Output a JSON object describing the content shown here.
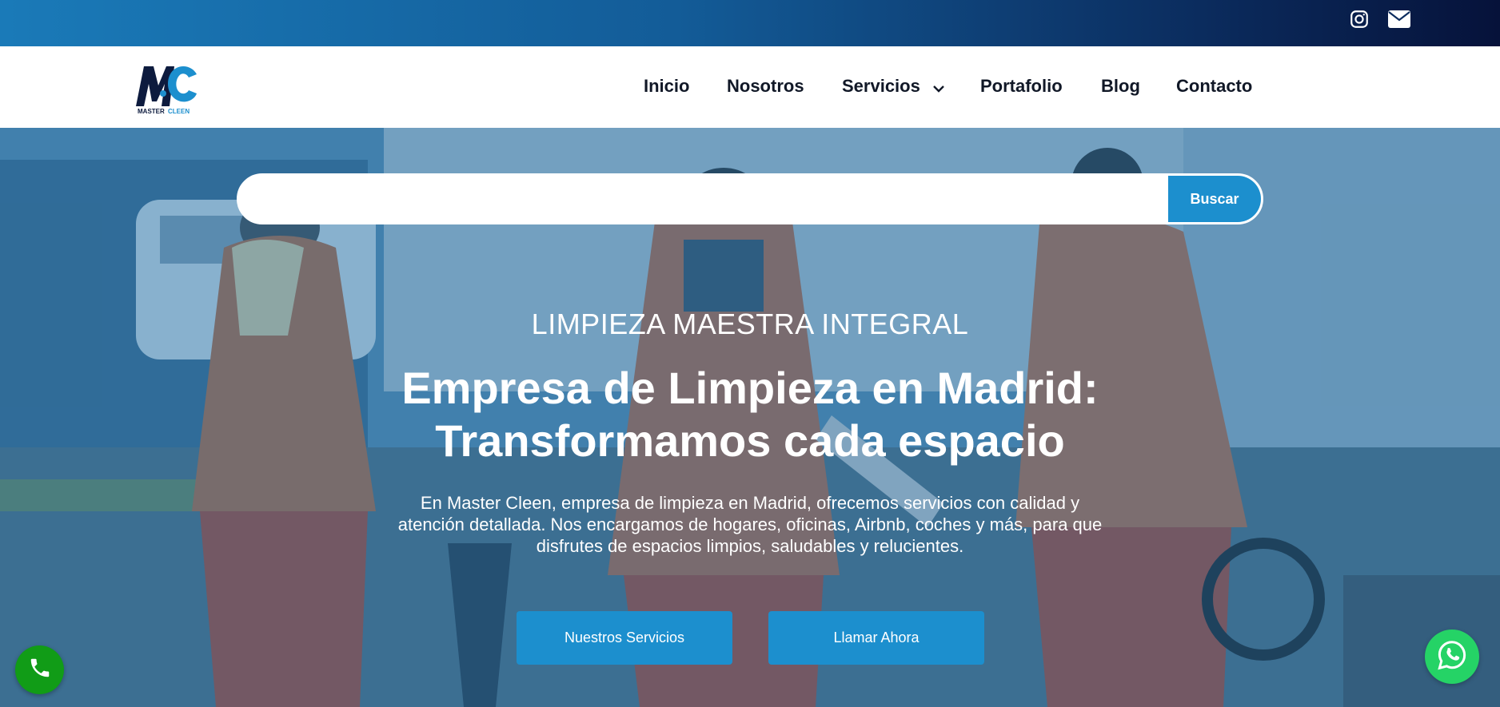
{
  "topbar": {
    "icons": [
      "instagram-icon",
      "mail-icon"
    ]
  },
  "header": {
    "logo": {
      "name": "Master Cleen logo",
      "letters": "MC",
      "wordmark": "MASTER CLEEN"
    },
    "nav": [
      {
        "label": "Inicio"
      },
      {
        "label": "Nosotros"
      },
      {
        "label": "Servicios",
        "has_dropdown": true
      },
      {
        "label": "Portafolio"
      },
      {
        "label": "Blog"
      },
      {
        "label": "Contacto"
      }
    ]
  },
  "search": {
    "value": "",
    "placeholder": "",
    "button_label": "Buscar"
  },
  "hero": {
    "eyebrow": "LIMPIEZA MAESTRA INTEGRAL",
    "title_line1": "Empresa de Limpieza en Madrid:",
    "title_line2": "Transformamos cada espacio",
    "description": "En Master Cleen, empresa de limpieza en Madrid, ofrecemos servicios con calidad y atención detallada. Nos encargamos de hogares, oficinas, Airbnb, coches y más, para que disfrutes de espacios limpios, saludables y relucientes.",
    "buttons": {
      "services": "Nuestros Servicios",
      "call": "Llamar Ahora"
    }
  },
  "floating": {
    "call_icon": "phone-icon",
    "whatsapp_icon": "whatsapp-icon"
  },
  "colors": {
    "topbar_start": "#1a7ab8",
    "topbar_end": "#06123a",
    "accent": "#1c8fce",
    "nav_text": "#111827",
    "call_green": "#119c17",
    "whatsapp_green": "#25d366"
  }
}
